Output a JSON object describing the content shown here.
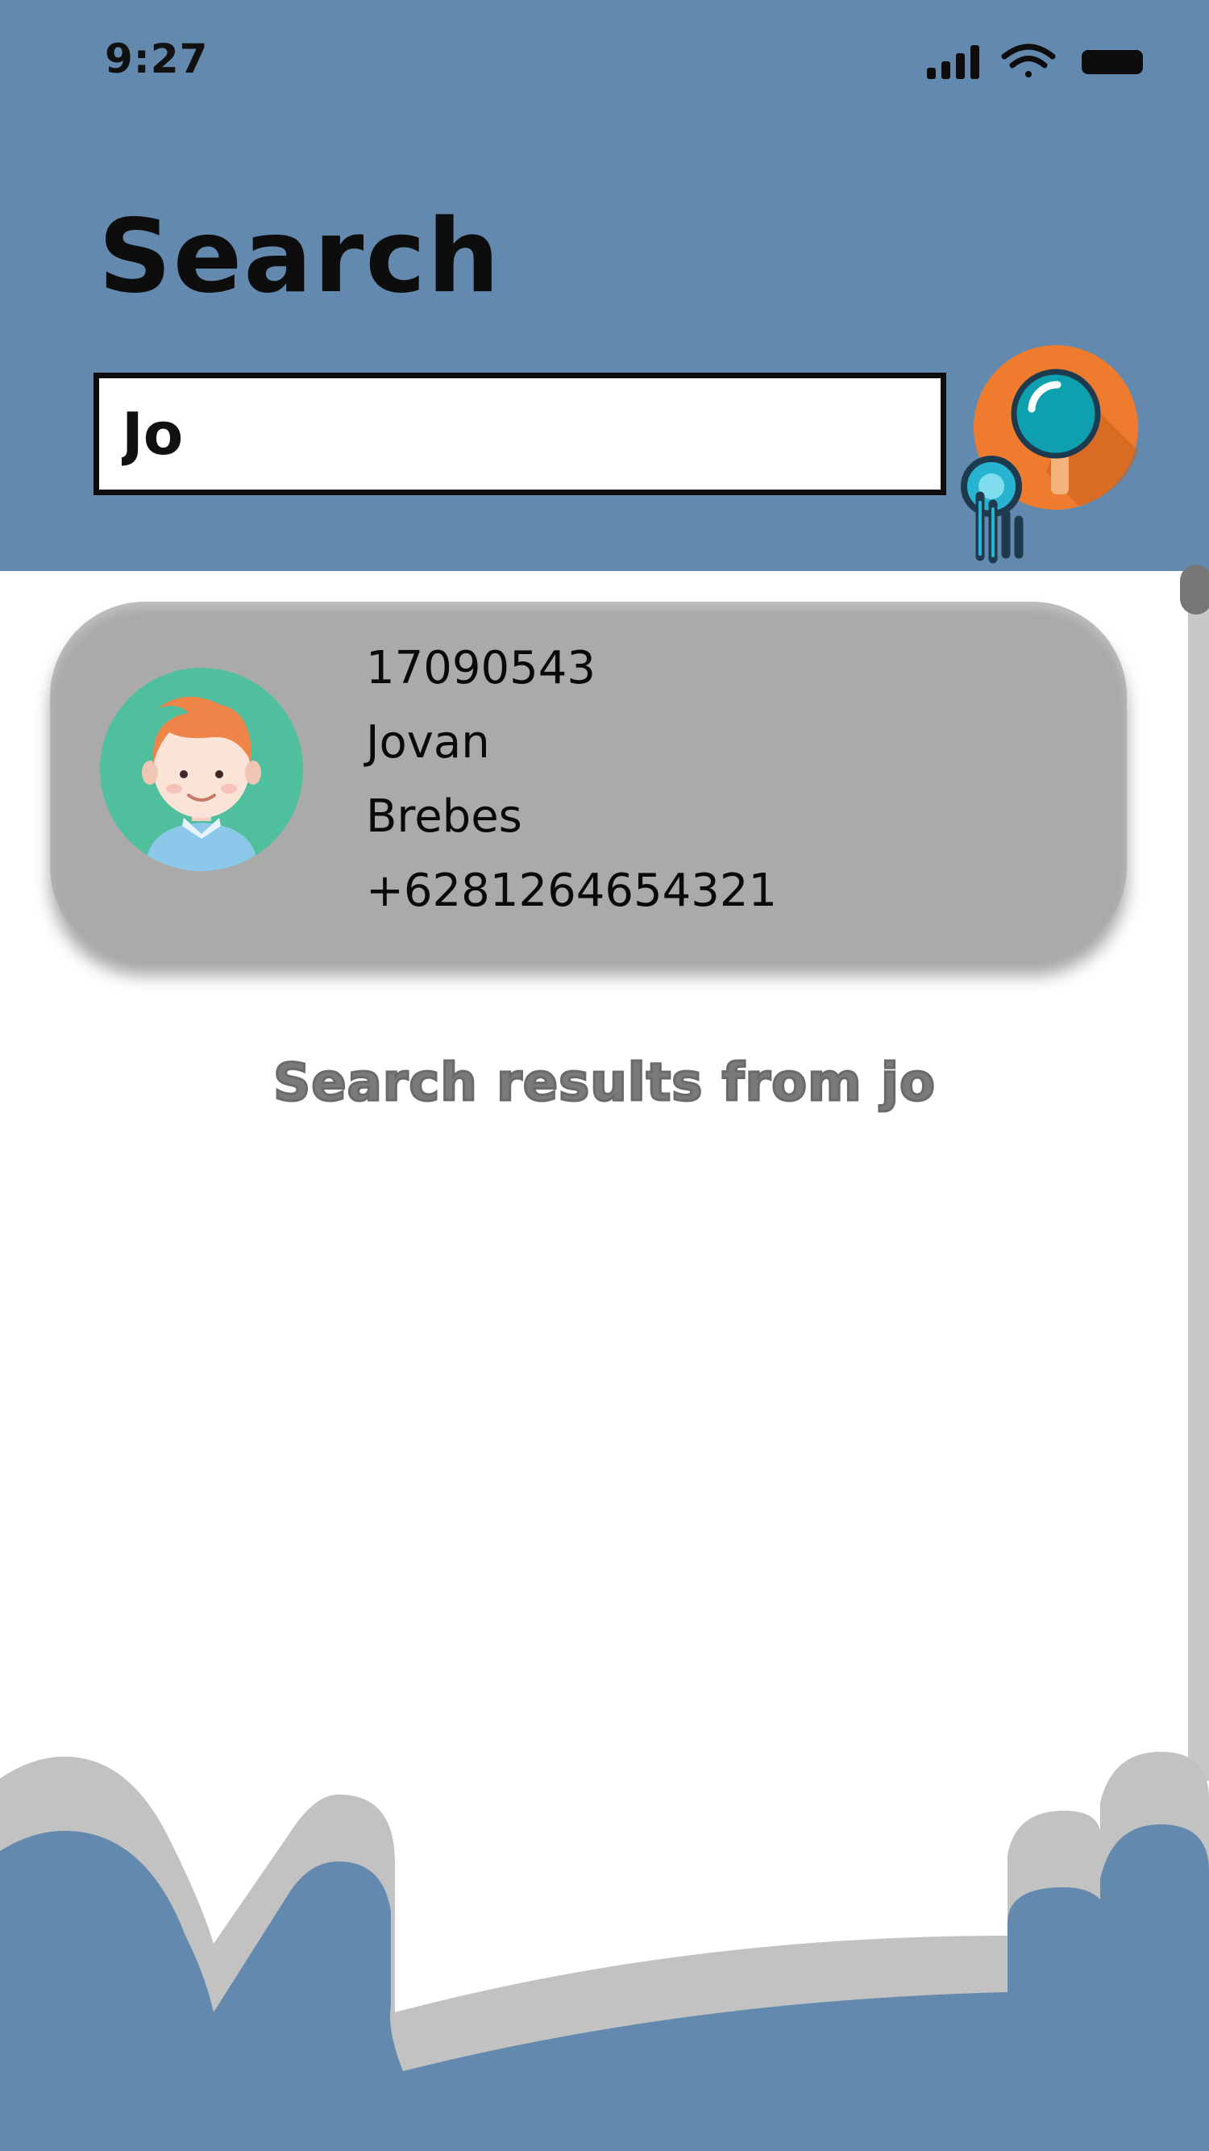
{
  "status_bar": {
    "time": "9:27"
  },
  "header": {
    "title": "Search"
  },
  "search": {
    "value": "Jo"
  },
  "result": {
    "id": "17090543",
    "name": "Jovan",
    "city": "Brebes",
    "phone": "+6281264654321"
  },
  "results_caption": "Search results from jo",
  "colors": {
    "header_bg": "#6389af",
    "card_bg": "#aaaaaa",
    "accent_orange": "#ef7c2e",
    "accent_teal": "#0fa0b0"
  }
}
